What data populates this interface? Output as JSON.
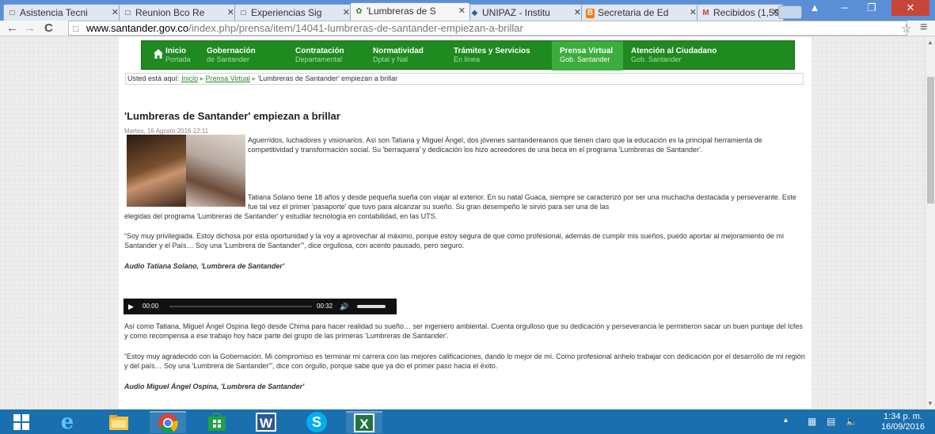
{
  "browser": {
    "tabs": [
      {
        "title": "Asistencia Tecni",
        "icon": "page"
      },
      {
        "title": "Reunion Bco Re",
        "icon": "page"
      },
      {
        "title": "Experiencias Sig",
        "icon": "page"
      },
      {
        "title": "'Lumbreras de S",
        "icon": "site-favicon"
      },
      {
        "title": "UNIPAZ - Institu",
        "icon": "unipaz"
      },
      {
        "title": "Secretaria de Ed",
        "icon": "blogger"
      },
      {
        "title": "Recibidos (1,59",
        "icon": "gmail"
      }
    ],
    "url_host": "www.santander.gov.co",
    "url_path": "/index.php/prensa/item/14041-lumbreras-de-santander-empiezan-a-brillar"
  },
  "site": {
    "nav": [
      {
        "title": "Inicio",
        "subtitle": "Portada"
      },
      {
        "title": "Gobernación",
        "subtitle": "de Santander"
      },
      {
        "title": "Contratación",
        "subtitle": "Departamental"
      },
      {
        "title": "Normatividad",
        "subtitle": "Dptal y Nal"
      },
      {
        "title": "Trámites y Servicios",
        "subtitle": "En línea"
      },
      {
        "title": "Prensa Virtual",
        "subtitle": "Gob. Santander"
      },
      {
        "title": "Atención al Ciudadano",
        "subtitle": "Gob. Santander"
      }
    ],
    "breadcrumb": {
      "prefix": "Usted está aquí:",
      "home": "Inicio",
      "section": "Prensa Virtual",
      "current": "'Lumbreras de Santander' empiezan a brillar"
    }
  },
  "article": {
    "title": "'Lumbreras de Santander' empiezan a brillar",
    "date": "Martes, 16 Agosto 2016 12:11",
    "p1": "Aguerridos, luchadores y visionarios. Así son Tatiana y Miguel Ángel, dos jóvenes santandereanos que tienen claro que la educación es la principal herramienta de competitividad y transformación social. Su 'berraquera' y dedicación los hizo acreedores de una beca en el programa 'Lumbreras de Santander'.",
    "p2a": "Tatiana Solano tiene 18 años y desde pequeña sueña con viajar al exterior. En su natal Guaca, siempre se caracterizó por ser una muchacha destacada y perseverante. Este fue tal vez el primer 'pasaporte' que tuvo para alcanzar su sueño. Su gran desempeño le sirvió para ser una de las",
    "p2b": "elegidas del programa 'Lumbreras de Santander' y estudiar tecnología en contabilidad, en las UTS.",
    "p3": "“Soy muy privilegiada. Estoy dichosa por esta oportunidad y la voy a aprovechar al máximo, porque estoy segura de que como profesional, además de cumplir mis sueños, puedo aportar al mejoramiento de mi Santander y el País… Soy una 'Lumbrera de Santander'”, dice orgullosa, con acento pausado, pero seguro.",
    "audio1_label": "Audio Tatiana Solano, 'Lumbrera de Santander'",
    "player": {
      "current": "00:00",
      "duration": "00:32",
      "volume": 0.8
    },
    "p4": "Así como Tatiana, Miguel Ángel Ospina llegó desde Chima para hacer realidad su sueño… ser ingeniero ambiental. Cuenta orgulloso que su dedicación y perseverancia le permitieron sacar un buen puntaje del Icfes y como recompensa a ese trabajo hoy hace parte del grupo de las primeras 'Lumbreras de Santander'.",
    "p5": "“Estoy muy agradecido con la Gobernación. Mi compromiso es terminar mi carrera con las mejores calificaciones, dando lo mejor de mí. Como profesional anhelo trabajar con dedicación por el desarrollo de mi región y del país… Soy una 'Lumbrera de Santander'”, dice con orgullo, porque sabe que ya dio el primer paso hacia el éxito.",
    "audio2_label": "Audio Miguel Ángel Ospina, 'Lumbrera de Santander'"
  },
  "taskbar": {
    "apps": [
      "start-icon",
      "internet-explorer-icon",
      "file-explorer-icon",
      "chrome-icon",
      "store-icon",
      "word-icon",
      "skype-icon",
      "excel-icon"
    ],
    "time": "1:34 p. m.",
    "date": "16/09/2016"
  }
}
